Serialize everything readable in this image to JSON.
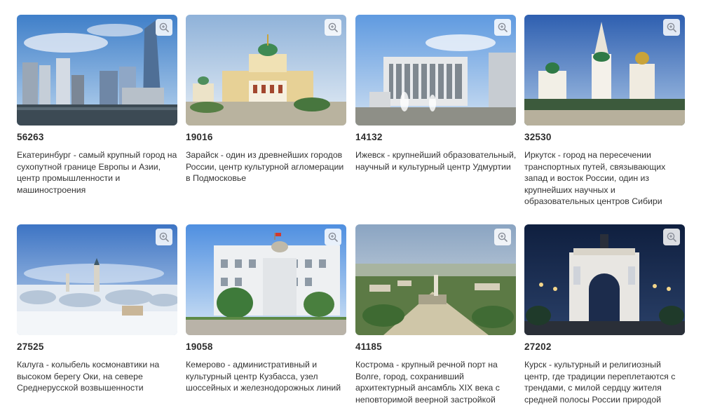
{
  "cards": [
    {
      "number": "56263",
      "text": "Екатеринбург - самый крупный город на сухопутной границе Европы и Азии, центр промышленности и машиностроения"
    },
    {
      "number": "19016",
      "text": "Зарайск - один из древнейших городов России, центр культурной агломерации в Подмосковье"
    },
    {
      "number": "14132",
      "text": "Ижевск - крупнейший образовательный, научный и культурный центр Удмуртии"
    },
    {
      "number": "32530",
      "text": "Иркутск - город на пересечении транспортных путей, связывающих запад и восток России, один из крупнейших научных и образовательных центров Сибири"
    },
    {
      "number": "27525",
      "text": "Калуга - колыбель космонавтики на высоком берегу Оки, на севере Среднерусской возвышенности"
    },
    {
      "number": "19058",
      "text": "Кемерово - административный и культурный центр Кузбасса, узел шоссейных и железнодорожных линий"
    },
    {
      "number": "41185",
      "text": "Кострома - крупный речной порт на Волге, город, сохранивший архитектурный ансамбль XIX века с неповторимой веерной застройкой"
    },
    {
      "number": "27202",
      "text": "Курск - культурный и религиозный центр, где традиции переплетаются с трендами, с милой сердцу жителя средней полосы России природой"
    }
  ],
  "icons": {
    "zoom": "zoom-in-icon"
  }
}
